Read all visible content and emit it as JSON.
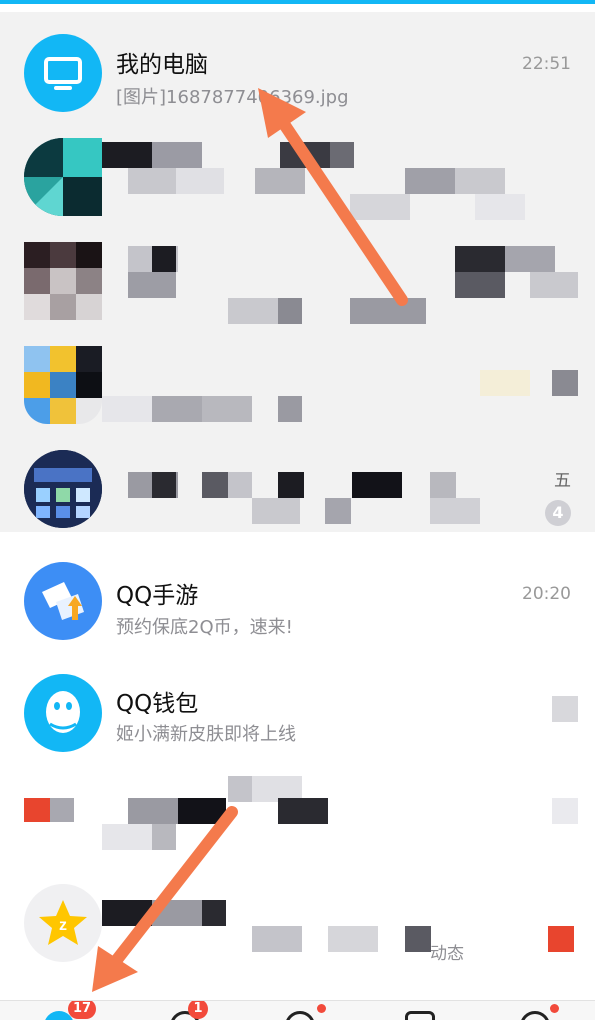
{
  "conversations": [
    {
      "title": "我的电脑",
      "preview": "[图片]1687877406369.jpg",
      "time": "22:51",
      "avatar_icon": "monitor-icon",
      "avatar_color": "#12b7f5"
    },
    {
      "title": "",
      "preview": "",
      "time": "",
      "redacted": true
    },
    {
      "title": "",
      "preview": "",
      "time": "",
      "redacted": true
    },
    {
      "title": "",
      "preview": "",
      "time": "",
      "redacted": true
    },
    {
      "title": "",
      "preview": "",
      "time": "五",
      "unread": "4",
      "redacted": true
    },
    {
      "title": "QQ手游",
      "preview": "预约保底2Q币，速来!",
      "time": "20:20",
      "avatar_icon": "qq-game-icon",
      "avatar_color": "#3d8ef5"
    },
    {
      "title": "QQ钱包",
      "preview": "姬小满新皮肤即将上线",
      "time": "",
      "avatar_icon": "qq-penguin-icon",
      "avatar_color": "#12b7f5"
    },
    {
      "title": "",
      "preview": "",
      "time": "",
      "redacted": true
    },
    {
      "title": "",
      "preview": "动态",
      "time": "",
      "avatar_icon": "qzone-star-icon",
      "avatar_color": "#ffc600",
      "redacted": true
    }
  ],
  "tabbar": {
    "messages_badge": "17",
    "contacts_badge": "1"
  },
  "colors": {
    "accent": "#12b7f5",
    "badge": "#f24a3b",
    "arrow": "#f47a4c"
  }
}
